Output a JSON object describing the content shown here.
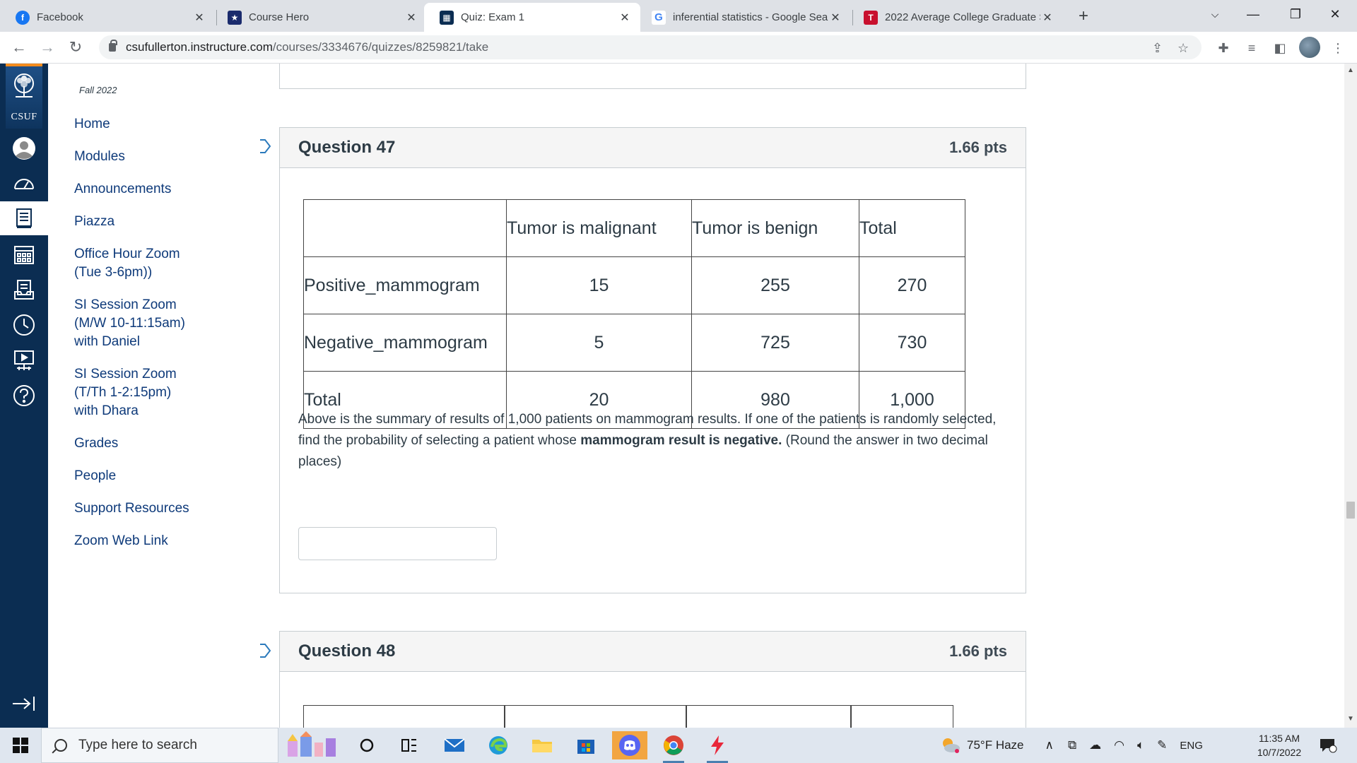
{
  "browser": {
    "tabs": [
      {
        "title": "Facebook",
        "favicon": "facebook-icon",
        "color": "#1877f2",
        "glyph": "f"
      },
      {
        "title": "Course Hero",
        "favicon": "course-hero-icon",
        "color": "#1a2b6d",
        "glyph": "★"
      },
      {
        "title": "Quiz: Exam 1",
        "favicon": "csuf-icon",
        "color": "#0b2d52",
        "glyph": "▦"
      },
      {
        "title": "inferential statistics - Google Sea",
        "favicon": "google-icon",
        "color": "#ffffff",
        "glyph": "G"
      },
      {
        "title": "2022 Average College Graduate S",
        "favicon": "t-icon",
        "color": "#c8102e",
        "glyph": "T"
      }
    ],
    "url_domain": "csufullerton.instructure.com",
    "url_path": "/courses/3334676/quizzes/8259821/take"
  },
  "course_nav": {
    "term": "Fall 2022",
    "links": [
      "Home",
      "Modules",
      "Announcements",
      "Piazza",
      "Office Hour Zoom (Tue 3-6pm))",
      "SI Session Zoom (M/W 10-11:15am) with Daniel",
      "SI Session Zoom (T/Th 1-2:15pm) with Dhara",
      "Grades",
      "People",
      "Support Resources",
      "Zoom Web Link"
    ]
  },
  "global_nav": {
    "logo_text": "CSUF",
    "icons": [
      "account-icon",
      "dashboard-icon",
      "courses-icon",
      "calendar-icon",
      "inbox-icon",
      "history-icon",
      "studio-icon",
      "help-icon",
      "collapse-nav-icon"
    ]
  },
  "question47": {
    "name": "Question 47",
    "points": "1.66 pts",
    "table": {
      "headers": [
        "",
        "Tumor is malignant",
        "Tumor is benign",
        "Total"
      ],
      "rows": [
        [
          "Positive_mammogram",
          "15",
          "255",
          "270"
        ],
        [
          "Negative_mammogram",
          "5",
          "725",
          "730"
        ],
        [
          "Total",
          "20",
          "980",
          "1,000"
        ]
      ]
    },
    "text_before": "Above is the summary of results of 1,000 patients on mammogram results. If one of the patients is randomly selected, find the probability of selecting a patient whose ",
    "text_bold": "mammogram result is negative.",
    "text_after": " (Round the answer in two decimal places)",
    "answer_value": ""
  },
  "question48": {
    "name": "Question 48",
    "points": "1.66 pts"
  },
  "taskbar": {
    "search_placeholder": "Type here to search",
    "weather": "75°F  Haze",
    "language": "ENG",
    "time": "11:35 AM",
    "date": "10/7/2022",
    "notification_count": "1"
  },
  "colors": {
    "canvas_nav": "#0b2d52",
    "link": "#0e3a7a",
    "accent_orange": "#f38b1c"
  }
}
